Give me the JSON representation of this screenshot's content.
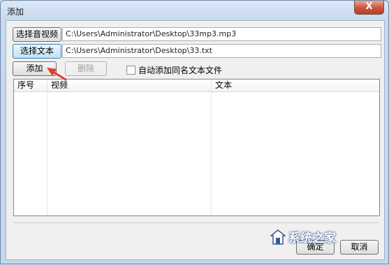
{
  "window": {
    "title": "添加",
    "close_glyph": "X"
  },
  "buttons": {
    "select_av": "选择音视频",
    "select_text": "选择文本",
    "add": "添加",
    "delete": "删除",
    "ok": "确定",
    "cancel": "取消"
  },
  "fields": {
    "av_path": "C:\\Users\\Administrator\\Desktop\\33mp3.mp3",
    "text_path": "C:\\Users\\Administrator\\Desktop\\33.txt"
  },
  "checkbox": {
    "label": "自动添加同名文本文件",
    "checked": false
  },
  "table": {
    "columns": [
      "序号",
      "视频",
      "文本"
    ],
    "rows": []
  },
  "watermark": {
    "text": "系统之家"
  },
  "colors": {
    "arrow": "#e53d2f",
    "accent": "#3c7fb1"
  }
}
